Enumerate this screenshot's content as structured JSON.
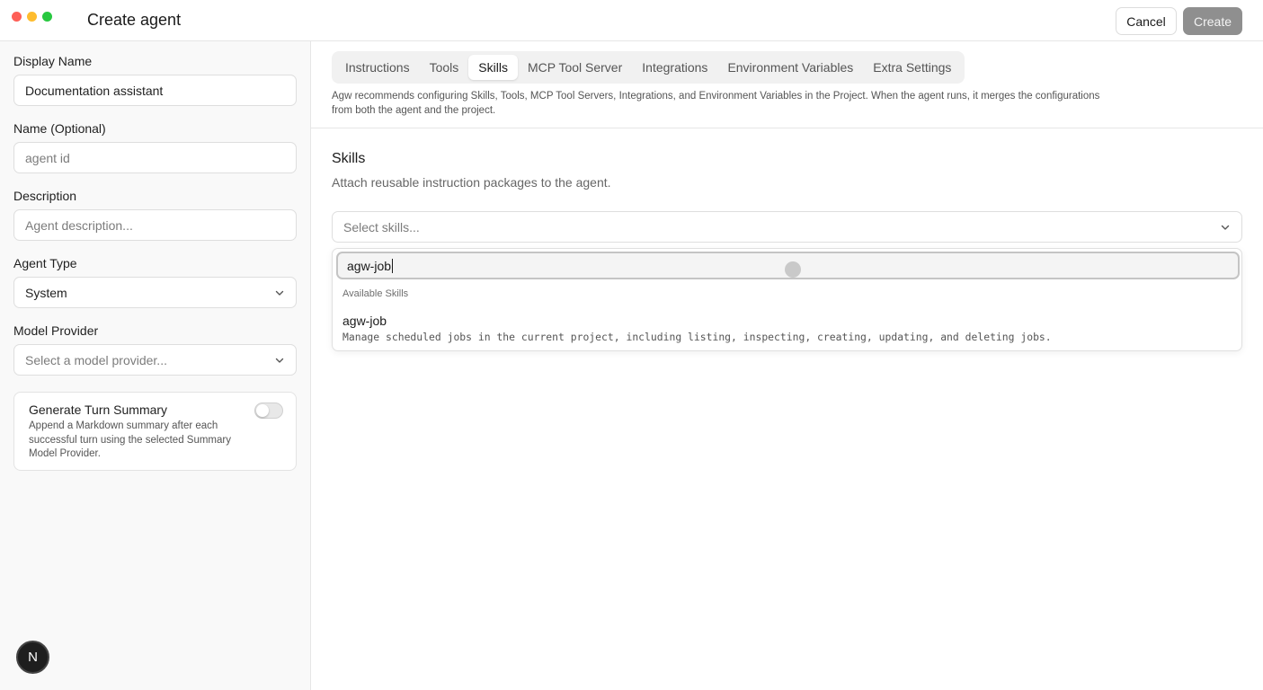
{
  "window": {
    "title": "Create agent"
  },
  "header": {
    "cancel_label": "Cancel",
    "create_label": "Create"
  },
  "form": {
    "display_name": {
      "label": "Display Name",
      "value": "Documentation assistant"
    },
    "name": {
      "label": "Name (Optional)",
      "placeholder": "agent id"
    },
    "description": {
      "label": "Description",
      "placeholder": "Agent description..."
    },
    "agent_type": {
      "label": "Agent Type",
      "value": "System"
    },
    "model_provider": {
      "label": "Model Provider",
      "placeholder": "Select a model provider..."
    },
    "turn_summary": {
      "title": "Generate Turn Summary",
      "description": "Append a Markdown summary after each successful turn using the selected Summary Model Provider.",
      "enabled": false
    }
  },
  "avatar": {
    "initial": "N"
  },
  "tabs": [
    {
      "label": "Instructions"
    },
    {
      "label": "Tools"
    },
    {
      "label": "Skills",
      "active": true
    },
    {
      "label": "MCP Tool Server"
    },
    {
      "label": "Integrations"
    },
    {
      "label": "Environment Variables"
    },
    {
      "label": "Extra Settings"
    }
  ],
  "info_text": "Agw recommends configuring Skills, Tools, MCP Tool Servers, Integrations, and Environment Variables in the Project. When the agent runs, it merges the configurations from both the agent and the project.",
  "skills": {
    "title": "Skills",
    "subtitle": "Attach reusable instruction packages to the agent.",
    "select_placeholder": "Select skills...",
    "search_value": "agw-job",
    "group_label": "Available Skills",
    "options": [
      {
        "name": "agw-job",
        "description": "Manage scheduled jobs in the current project, including listing, inspecting, creating, updating, and deleting jobs."
      }
    ]
  },
  "icons": {
    "dropdown": "chevron-down-icon",
    "toggle": "toggle-switch"
  },
  "colors": {
    "create_button_bg": "#8f8f8f",
    "traffic_red": "#fe5f57",
    "traffic_yellow": "#febc2e",
    "traffic_green": "#28c840"
  }
}
